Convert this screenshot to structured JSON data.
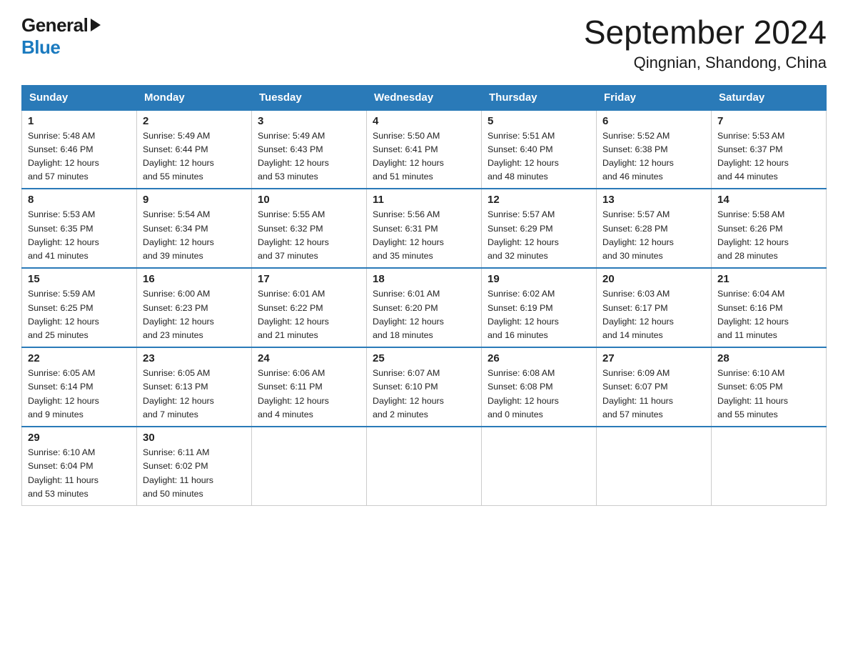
{
  "logo": {
    "general": "General",
    "blue": "Blue"
  },
  "header": {
    "month_year": "September 2024",
    "location": "Qingnian, Shandong, China"
  },
  "days_of_week": [
    "Sunday",
    "Monday",
    "Tuesday",
    "Wednesday",
    "Thursday",
    "Friday",
    "Saturday"
  ],
  "weeks": [
    [
      {
        "day": "1",
        "sunrise": "5:48 AM",
        "sunset": "6:46 PM",
        "daylight": "12 hours and 57 minutes"
      },
      {
        "day": "2",
        "sunrise": "5:49 AM",
        "sunset": "6:44 PM",
        "daylight": "12 hours and 55 minutes"
      },
      {
        "day": "3",
        "sunrise": "5:49 AM",
        "sunset": "6:43 PM",
        "daylight": "12 hours and 53 minutes"
      },
      {
        "day": "4",
        "sunrise": "5:50 AM",
        "sunset": "6:41 PM",
        "daylight": "12 hours and 51 minutes"
      },
      {
        "day": "5",
        "sunrise": "5:51 AM",
        "sunset": "6:40 PM",
        "daylight": "12 hours and 48 minutes"
      },
      {
        "day": "6",
        "sunrise": "5:52 AM",
        "sunset": "6:38 PM",
        "daylight": "12 hours and 46 minutes"
      },
      {
        "day": "7",
        "sunrise": "5:53 AM",
        "sunset": "6:37 PM",
        "daylight": "12 hours and 44 minutes"
      }
    ],
    [
      {
        "day": "8",
        "sunrise": "5:53 AM",
        "sunset": "6:35 PM",
        "daylight": "12 hours and 41 minutes"
      },
      {
        "day": "9",
        "sunrise": "5:54 AM",
        "sunset": "6:34 PM",
        "daylight": "12 hours and 39 minutes"
      },
      {
        "day": "10",
        "sunrise": "5:55 AM",
        "sunset": "6:32 PM",
        "daylight": "12 hours and 37 minutes"
      },
      {
        "day": "11",
        "sunrise": "5:56 AM",
        "sunset": "6:31 PM",
        "daylight": "12 hours and 35 minutes"
      },
      {
        "day": "12",
        "sunrise": "5:57 AM",
        "sunset": "6:29 PM",
        "daylight": "12 hours and 32 minutes"
      },
      {
        "day": "13",
        "sunrise": "5:57 AM",
        "sunset": "6:28 PM",
        "daylight": "12 hours and 30 minutes"
      },
      {
        "day": "14",
        "sunrise": "5:58 AM",
        "sunset": "6:26 PM",
        "daylight": "12 hours and 28 minutes"
      }
    ],
    [
      {
        "day": "15",
        "sunrise": "5:59 AM",
        "sunset": "6:25 PM",
        "daylight": "12 hours and 25 minutes"
      },
      {
        "day": "16",
        "sunrise": "6:00 AM",
        "sunset": "6:23 PM",
        "daylight": "12 hours and 23 minutes"
      },
      {
        "day": "17",
        "sunrise": "6:01 AM",
        "sunset": "6:22 PM",
        "daylight": "12 hours and 21 minutes"
      },
      {
        "day": "18",
        "sunrise": "6:01 AM",
        "sunset": "6:20 PM",
        "daylight": "12 hours and 18 minutes"
      },
      {
        "day": "19",
        "sunrise": "6:02 AM",
        "sunset": "6:19 PM",
        "daylight": "12 hours and 16 minutes"
      },
      {
        "day": "20",
        "sunrise": "6:03 AM",
        "sunset": "6:17 PM",
        "daylight": "12 hours and 14 minutes"
      },
      {
        "day": "21",
        "sunrise": "6:04 AM",
        "sunset": "6:16 PM",
        "daylight": "12 hours and 11 minutes"
      }
    ],
    [
      {
        "day": "22",
        "sunrise": "6:05 AM",
        "sunset": "6:14 PM",
        "daylight": "12 hours and 9 minutes"
      },
      {
        "day": "23",
        "sunrise": "6:05 AM",
        "sunset": "6:13 PM",
        "daylight": "12 hours and 7 minutes"
      },
      {
        "day": "24",
        "sunrise": "6:06 AM",
        "sunset": "6:11 PM",
        "daylight": "12 hours and 4 minutes"
      },
      {
        "day": "25",
        "sunrise": "6:07 AM",
        "sunset": "6:10 PM",
        "daylight": "12 hours and 2 minutes"
      },
      {
        "day": "26",
        "sunrise": "6:08 AM",
        "sunset": "6:08 PM",
        "daylight": "12 hours and 0 minutes"
      },
      {
        "day": "27",
        "sunrise": "6:09 AM",
        "sunset": "6:07 PM",
        "daylight": "11 hours and 57 minutes"
      },
      {
        "day": "28",
        "sunrise": "6:10 AM",
        "sunset": "6:05 PM",
        "daylight": "11 hours and 55 minutes"
      }
    ],
    [
      {
        "day": "29",
        "sunrise": "6:10 AM",
        "sunset": "6:04 PM",
        "daylight": "11 hours and 53 minutes"
      },
      {
        "day": "30",
        "sunrise": "6:11 AM",
        "sunset": "6:02 PM",
        "daylight": "11 hours and 50 minutes"
      },
      null,
      null,
      null,
      null,
      null
    ]
  ],
  "labels": {
    "sunrise": "Sunrise:",
    "sunset": "Sunset:",
    "daylight": "Daylight:"
  }
}
